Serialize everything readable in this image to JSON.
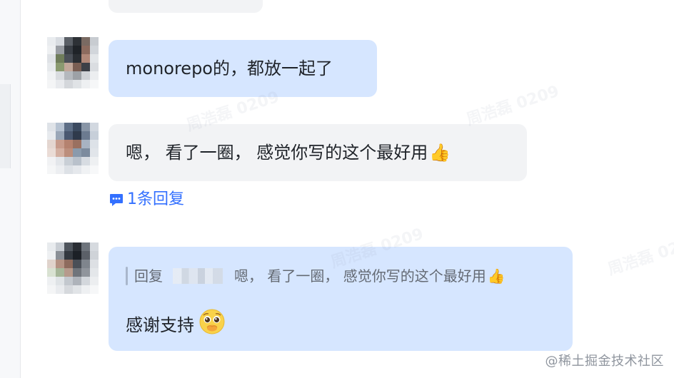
{
  "messages": [
    {
      "text": "monorepo的，都放一起了",
      "emoji": ""
    },
    {
      "text": "嗯， 看了一圈， 感觉你写的这个最好用",
      "emoji": "👍"
    }
  ],
  "reply_thread": {
    "label": "1条回复"
  },
  "reply_message": {
    "quote_prefix": "回复",
    "quote_text": "嗯， 看了一圈， 感觉你写的这个最好用",
    "quote_emoji": "👍",
    "text": "感谢支持"
  },
  "watermark_texts": [
    "周浩磊 0209",
    "周浩磊 0209",
    "周浩磊 0209",
    "周浩磊 0209"
  ],
  "source_credit": "@稀土掘金技术社区",
  "colors": {
    "bubble_blue": "#d6e6ff",
    "bubble_gray": "#f2f3f5",
    "link_blue": "#3370ff"
  },
  "icons": [
    "comment-icon",
    "thumbs-up-emoji",
    "pleading-face-emoji"
  ]
}
